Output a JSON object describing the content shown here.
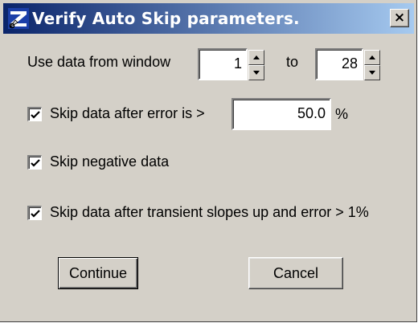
{
  "dialog": {
    "title": "Verify Auto Skip parameters.",
    "close_label": "×"
  },
  "window_range": {
    "label": "Use data from window",
    "from_value": "1",
    "to_label": "to",
    "to_value": "28"
  },
  "options": [
    {
      "label": "Skip data after error is >",
      "checked": true,
      "value": "50.0",
      "unit": "%"
    },
    {
      "label": "Skip negative data",
      "checked": true
    },
    {
      "label": "Skip data after transient slopes up and error > 1%",
      "checked": true
    }
  ],
  "buttons": {
    "continue_label": "Continue",
    "cancel_label": "Cancel"
  },
  "colors": {
    "titlebar_start": "#0a246a",
    "titlebar_end": "#a6caf0",
    "dialog_bg": "#d4d0c8"
  }
}
